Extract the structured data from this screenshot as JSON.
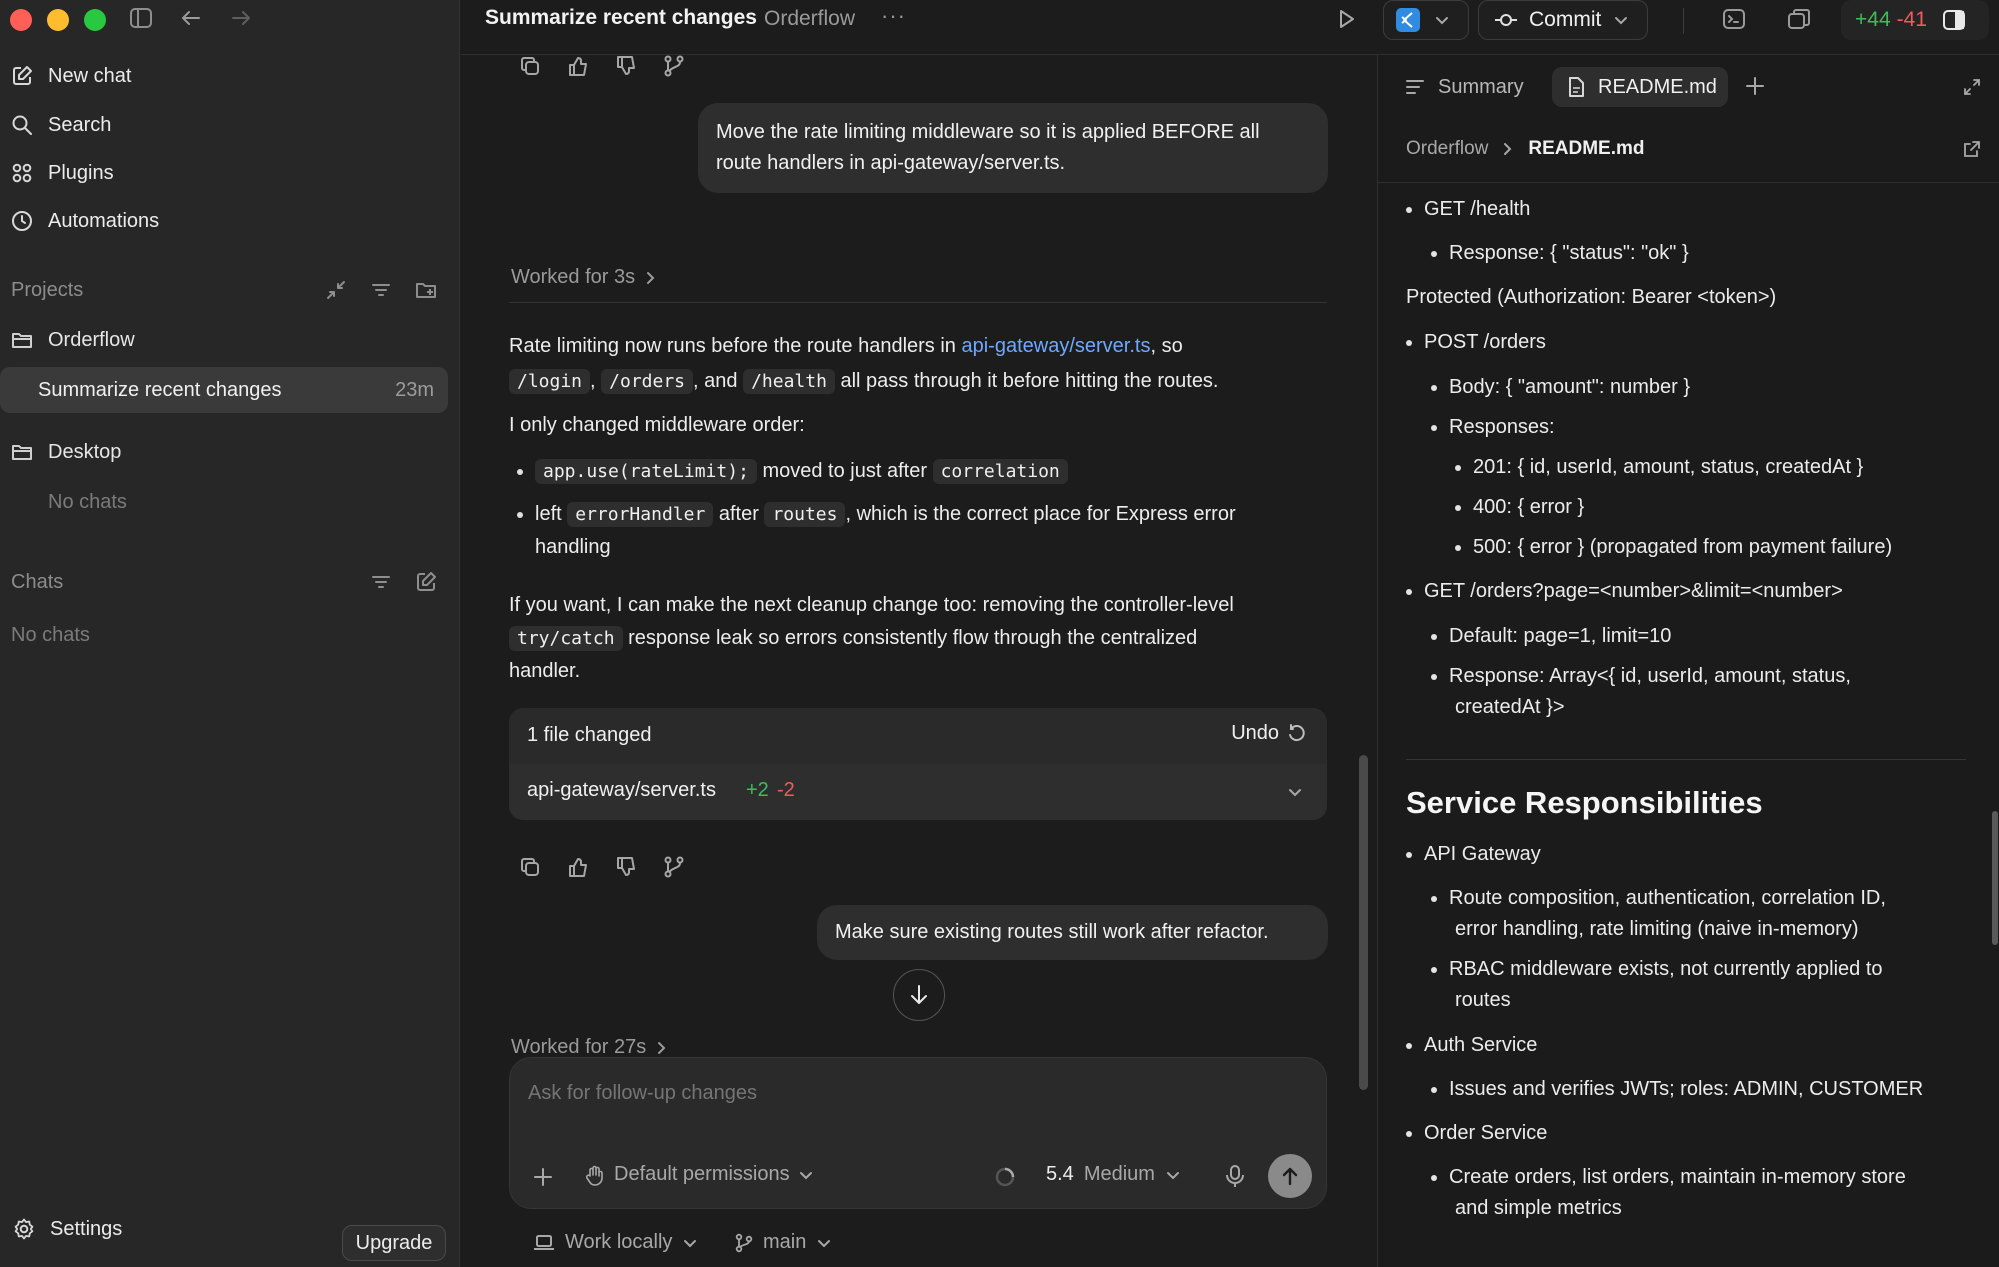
{
  "sidebar": {
    "nav": [
      {
        "label": "New chat",
        "icon": "compose-icon"
      },
      {
        "label": "Search",
        "icon": "search-icon"
      },
      {
        "label": "Plugins",
        "icon": "grid-icon"
      },
      {
        "label": "Automations",
        "icon": "clock-icon"
      }
    ],
    "projects_label": "Projects",
    "projects": [
      {
        "name": "Orderflow",
        "chats": [
          {
            "title": "Summarize recent changes",
            "time": "23m"
          }
        ]
      },
      {
        "name": "Desktop",
        "empty": "No chats"
      }
    ],
    "chats_label": "Chats",
    "chats_empty": "No chats",
    "settings_label": "Settings",
    "upgrade_label": "Upgrade"
  },
  "topbar": {
    "title": "Summarize recent changes",
    "project": "Orderflow",
    "more": "···",
    "commit_label": "Commit",
    "additions": "+44",
    "deletions": "-41"
  },
  "conversation": {
    "user_msg_1": "Move the rate limiting middleware so it is applied BEFORE all route handlers in api-gateway/server.ts.",
    "worked_1": "Worked for 3s",
    "reply": {
      "p1_a": "Rate limiting now runs before the route handlers in ",
      "p1_link": "api-gateway/server.ts",
      "p1_b": ", so",
      "code_login": "/login",
      "comma": ",",
      "code_orders": "/orders",
      "and": ", and",
      "code_health": "/health",
      "p1_c": "all pass through it before hitting the routes.",
      "p2": "I only changed middleware order:",
      "b1_code": "app.use(rateLimit);",
      "b1_text": "moved to just after",
      "b1_code2": "correlation",
      "b2_a": "left",
      "b2_code": "errorHandler",
      "b2_b": "after",
      "b2_code2": "routes",
      "b2_c": ", which is the correct place for Express error",
      "b2_d": "handling",
      "p3_a": "If you want, I can make the next cleanup change too: removing the controller-level",
      "p3_code": "try/catch",
      "p3_b": "response leak so errors consistently flow through the centralized",
      "p3_c": "handler."
    },
    "files_changed": {
      "title": "1 file changed",
      "undo": "Undo",
      "file": "api-gateway/server.ts",
      "add": "+2",
      "del": "-2"
    },
    "user_msg_2": "Make sure existing routes still work after refactor.",
    "worked_2": "Worked for 27s"
  },
  "composer": {
    "placeholder": "Ask for follow-up changes",
    "permissions": "Default permissions",
    "model": "5.4",
    "effort": "Medium",
    "work_mode": "Work locally",
    "branch": "main"
  },
  "right_panel": {
    "tabs": [
      {
        "label": "Summary"
      },
      {
        "label": "README.md"
      }
    ],
    "breadcrumb": [
      "Orderflow",
      "README.md"
    ],
    "lines": [
      {
        "level": 1,
        "text": "GET /health"
      },
      {
        "level": 2,
        "text": "Response: { \"status\": \"ok\" }"
      },
      {
        "level": 0,
        "text": "Protected (Authorization: Bearer <token>)"
      },
      {
        "level": 1,
        "text": "POST /orders"
      },
      {
        "level": 2,
        "text": "Body: { \"amount\": number }"
      },
      {
        "level": 2,
        "text": "Responses:"
      },
      {
        "level": 3,
        "text": "201: { id, userId, amount, status, createdAt }"
      },
      {
        "level": 3,
        "text": "400: { error }"
      },
      {
        "level": 3,
        "text": "500: { error } (propagated from payment failure)"
      },
      {
        "level": 1,
        "text": "GET /orders?page=<number>&limit=<number>"
      },
      {
        "level": 2,
        "text": "Default: page=1, limit=10"
      },
      {
        "level": 2,
        "text": "Response: Array<{ id, userId, amount, status,"
      },
      {
        "level": 9,
        "text": "createdAt }>"
      }
    ],
    "heading": "Service Responsibilities",
    "services": [
      {
        "level": 1,
        "text": "API Gateway"
      },
      {
        "level": 2,
        "text": "Route composition, authentication, correlation ID,"
      },
      {
        "level": 9,
        "text": "error handling, rate limiting (naive in-memory)"
      },
      {
        "level": 2,
        "text": "RBAC middleware exists, not currently applied to"
      },
      {
        "level": 9,
        "text": "routes"
      },
      {
        "level": 1,
        "text": "Auth Service"
      },
      {
        "level": 2,
        "text": "Issues and verifies JWTs; roles: ADMIN, CUSTOMER"
      },
      {
        "level": 1,
        "text": "Order Service"
      },
      {
        "level": 2,
        "text": "Create orders, list orders, maintain in-memory store"
      },
      {
        "level": 9,
        "text": "and simple metrics"
      }
    ]
  }
}
